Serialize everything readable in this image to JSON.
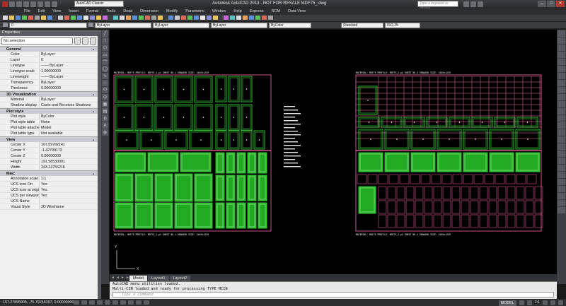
{
  "app": {
    "title": "Autodesk AutoCAD 2014 - NOT FOR RESALE   MDF75_.dwg",
    "workspace": "AutoCAD Classic",
    "search_placeholder": "Type a keyword or phrase"
  },
  "menu": [
    "File",
    "Edit",
    "View",
    "Insert",
    "Format",
    "Tools",
    "Draw",
    "Dimension",
    "Modify",
    "Parametric",
    "Window",
    "Help",
    "Express",
    "RCM",
    "Data View"
  ],
  "toolbar": {
    "layer_value": "0",
    "style_value": "Standard",
    "dim_style_value": "ISO-25",
    "color_value": "ByLayer",
    "linetype_value": "ByLayer",
    "lineweight_value": "ByLayer",
    "plotstyle_value": "ByColor"
  },
  "properties": {
    "header": "Properties",
    "selection": "No selection",
    "sections": [
      {
        "name": "General",
        "rows": [
          {
            "k": "Color",
            "v": "ByLayer"
          },
          {
            "k": "Layer",
            "v": "0"
          },
          {
            "k": "Linetype",
            "v": "—— ByLayer"
          },
          {
            "k": "Linetype scale",
            "v": "1.00000000"
          },
          {
            "k": "Lineweight",
            "v": "—— ByLayer"
          },
          {
            "k": "Transparency",
            "v": "ByLayer"
          },
          {
            "k": "Thickness",
            "v": "0.00000000"
          }
        ]
      },
      {
        "name": "3D Visualization",
        "rows": [
          {
            "k": "Material",
            "v": "ByLayer"
          },
          {
            "k": "Shadow display",
            "v": "Casts and Receives Shadows"
          }
        ]
      },
      {
        "name": "Plot style",
        "rows": [
          {
            "k": "Plot style",
            "v": "ByColor"
          },
          {
            "k": "Plot style table",
            "v": "None"
          },
          {
            "k": "Plot table attached to",
            "v": "Model"
          },
          {
            "k": "Plot table type",
            "v": "Not available"
          }
        ]
      },
      {
        "name": "View",
        "rows": [
          {
            "k": "Center X",
            "v": "167.59782141"
          },
          {
            "k": "Center Y",
            "v": "-1.42799173"
          },
          {
            "k": "Center Z",
            "v": "0.00000000"
          },
          {
            "k": "Height",
            "v": "191.58530001"
          },
          {
            "k": "Width",
            "v": "343.24755216"
          }
        ]
      },
      {
        "name": "Misc",
        "rows": [
          {
            "k": "Annotation scale",
            "v": "1:1"
          },
          {
            "k": "UCS icon On",
            "v": "Yes"
          },
          {
            "k": "UCS icon at origin",
            "v": "Yes"
          },
          {
            "k": "UCS per viewport",
            "v": "Yes"
          },
          {
            "k": "UCS Name",
            "v": ""
          },
          {
            "k": "Visual Style",
            "v": "2D Wireframe"
          }
        ]
      }
    ]
  },
  "tabs": [
    "Model",
    "Layout1",
    "Layout2"
  ],
  "command": {
    "lines": [
      "AutoCAD menu utilities loaded.",
      "Multi-CIN loaded and ready for processing TYPE MCIN"
    ],
    "placeholder": "Type a command"
  },
  "status": {
    "coords": "157.27895905, -75.79246397, 0.00000000",
    "space": "MODEL",
    "scale": "1:1"
  },
  "colors": {
    "canvas": "#000000",
    "sheet_border": "#ff66aa",
    "panel_fill": "#22aa22",
    "panel_line": "#44ff44",
    "text": "#ffffff"
  },
  "drawing": {
    "left_sheet_title": "MATERIAL: MDF75  PROFILE: MDF75_1.p1  SHEET NO.1  DRAWING SIZE: 2440x1220",
    "left_sheet_footer": "MATERIAL: MDF75  PROFILE: MDF75_1.p1  SHEET NO.1  DRAWING SIZE: 2440x1220",
    "right_sheet_title": "MATERIAL: MDF75  PROFILE: MDF75_2.p2  SHEET NO.2  DRAWING SIZE: 2440x1220",
    "right_sheet_footer": "MATERIAL: MDF75  PROFILE: MDF75_2.p2  SHEET NO.2  DRAWING SIZE: 2440x1220"
  }
}
